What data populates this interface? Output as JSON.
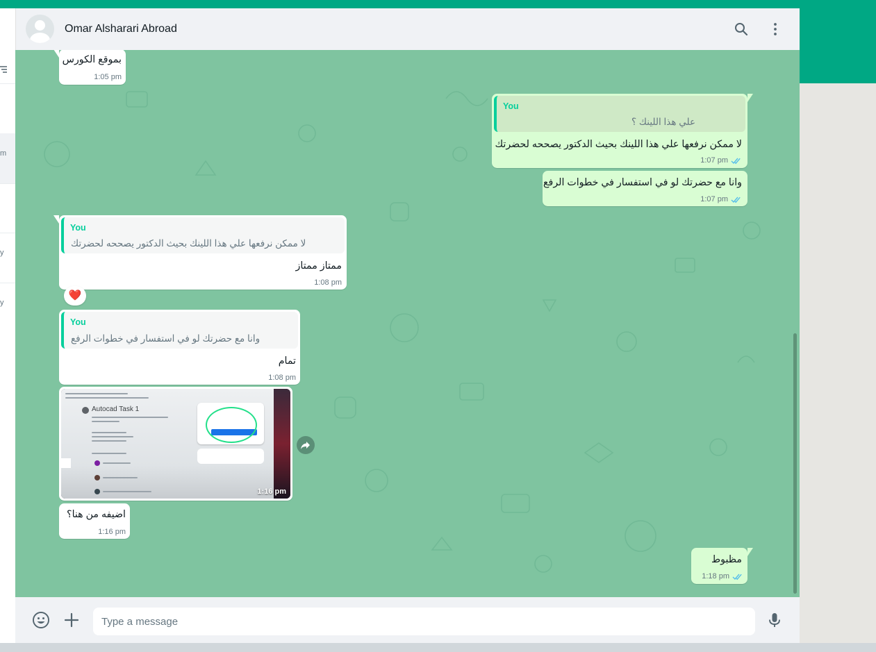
{
  "contact": {
    "name": "Omar Alsharari Abroad"
  },
  "sidebar_fragments": {
    "row1": "m",
    "row2": "y",
    "row3": "y"
  },
  "messages": [
    {
      "direction": "in",
      "text": "بموقع الكورس",
      "time": "1:05 pm"
    },
    {
      "direction": "out",
      "quote_author": "You",
      "quote_text": "علي هذا اللينك ؟",
      "text": "لا ممكن نرفعها علي هذا اللينك بحيث الدكتور يصححه لحضرتك",
      "time": "1:07 pm",
      "status": "read"
    },
    {
      "direction": "out",
      "text": "وانا مع حضرتك لو في استفسار في خطوات الرفع",
      "time": "1:07 pm",
      "status": "read"
    },
    {
      "direction": "in",
      "quote_author": "You",
      "quote_text": "لا ممكن نرفعها علي هذا اللينك بحيث الدكتور يصححه لحضرتك",
      "text": "ممتاز ممتاز",
      "time": "1:08 pm",
      "reaction": "❤️"
    },
    {
      "direction": "in",
      "quote_author": "You",
      "quote_text": "وانا مع حضرتك لو في استفسار في خطوات الرفع",
      "text": "تمام",
      "time": "1:08 pm"
    },
    {
      "direction": "in",
      "type": "image",
      "image_title": "Autocad Task 1",
      "time": "1:16 pm"
    },
    {
      "direction": "in",
      "text": "اضيفه من هنا؟",
      "time": "1:16 pm"
    },
    {
      "direction": "out",
      "text": "مظبوط",
      "time": "1:18 pm",
      "status": "read"
    }
  ],
  "composer": {
    "placeholder": "Type a message"
  },
  "icons": {
    "search": "search-icon",
    "menu": "kebab-menu-icon",
    "emoji": "emoji-icon",
    "attach": "plus-icon",
    "mic": "microphone-icon",
    "forward": "forward-icon",
    "read_receipt": "double-check-icon"
  },
  "colors": {
    "brand": "#00a884",
    "out_bubble": "#d9fdd3",
    "in_bubble": "#ffffff",
    "read_ticks": "#53bdeb",
    "quote_bar": "#06cf9c"
  }
}
